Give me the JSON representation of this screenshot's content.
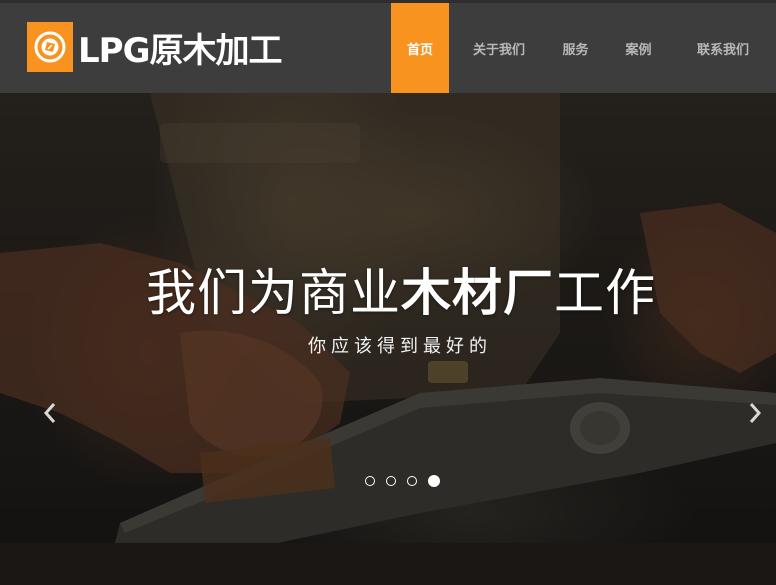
{
  "brand": {
    "name": "LPG原木加工",
    "logo_color": "#f7931e"
  },
  "nav": {
    "items": [
      {
        "label": "首页",
        "active": true
      },
      {
        "label": "关于我们",
        "active": false
      },
      {
        "label": "服务",
        "active": false
      },
      {
        "label": "案例",
        "active": false
      },
      {
        "label": "联系我们",
        "active": false
      }
    ]
  },
  "hero": {
    "title_part1": "我们为商业",
    "title_part2": "木材厂",
    "title_part3": "工作",
    "subtitle": "你应该得到最好的",
    "slides_total": 4,
    "active_slide": 4
  },
  "icons": {
    "logo": "compass-icon",
    "prev": "chevron-left-icon",
    "next": "chevron-right-icon"
  },
  "colors": {
    "accent": "#f7931e",
    "header_bg": "#3d3d3d",
    "nav_text": "#b8b8b8"
  }
}
